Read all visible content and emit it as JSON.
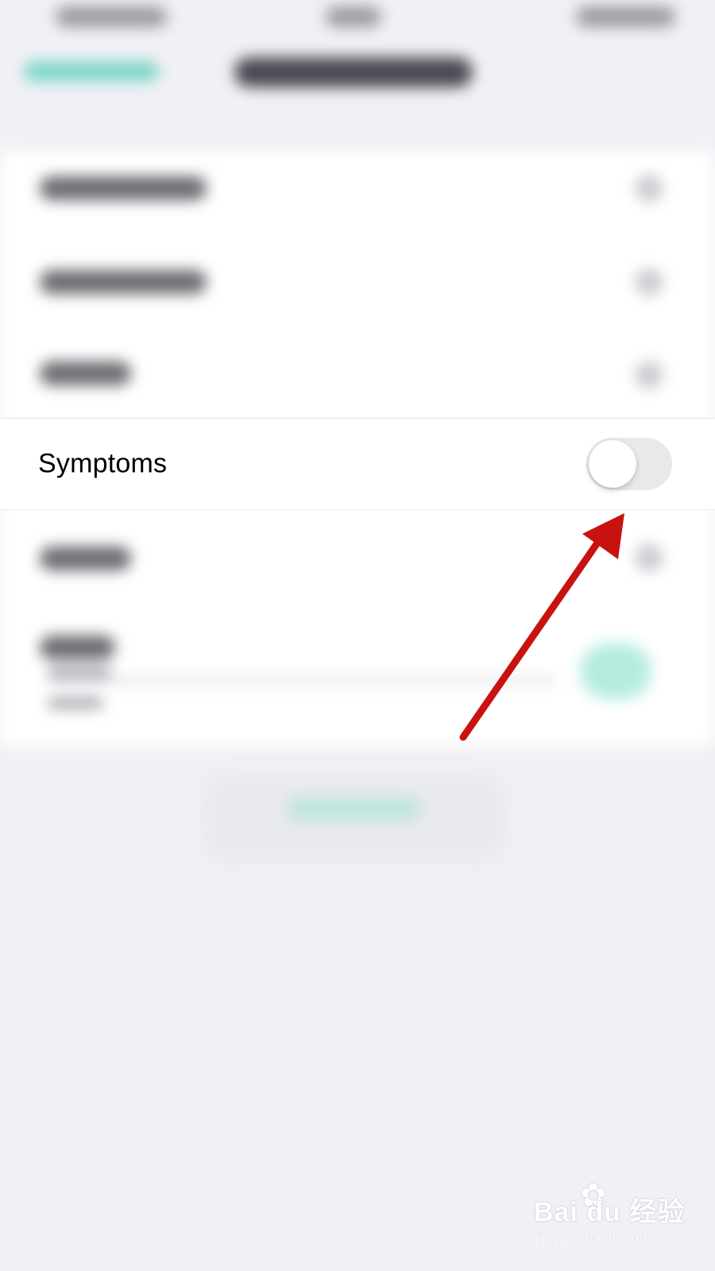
{
  "row": {
    "label": "Symptoms",
    "toggle_on": false
  },
  "colors": {
    "page_background": "#f0f0f5",
    "toggle_off_track": "#e9e9eb",
    "arrow_annotation": "#c8120f",
    "accent_blurred": "#78d6c8"
  },
  "watermark": {
    "logo_text": "Bai du 经验",
    "url": "jingyan.baidu.com"
  }
}
